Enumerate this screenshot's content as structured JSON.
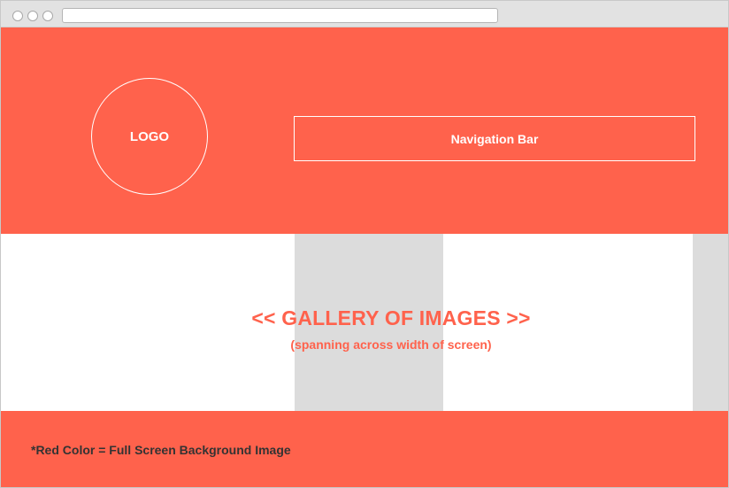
{
  "header": {
    "logo_label": "LOGO",
    "nav_label": "Navigation Bar"
  },
  "gallery": {
    "title": "<< GALLERY OF IMAGES >>",
    "subtitle": "(spanning across width of screen)"
  },
  "footer": {
    "note": "*Red Color = Full Screen Background Image"
  },
  "colors": {
    "accent": "#ff624c",
    "gallery_placeholder": "#dcdcdc",
    "text_dark": "#333333"
  }
}
